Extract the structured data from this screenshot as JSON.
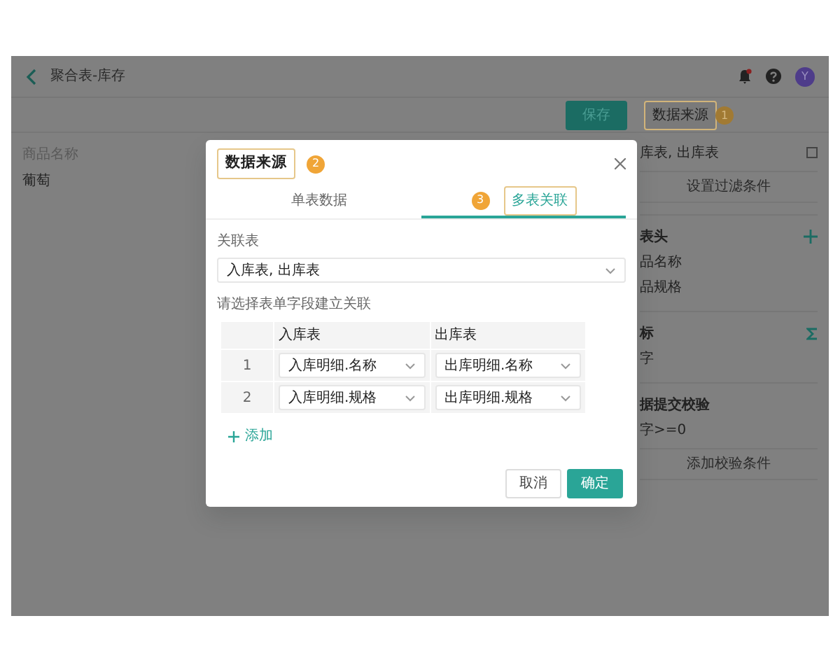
{
  "header": {
    "title": "聚合表-库存",
    "avatar": "Y"
  },
  "toolbar": {
    "save_button": "保存",
    "source_button": {
      "label": "数据来源",
      "highlighted": true,
      "badge": "1"
    }
  },
  "content": {
    "label": "商品名称",
    "value": "葡萄"
  },
  "right_panel": {
    "source_value": "库表, 出库表",
    "filter_button": "设置过滤条件",
    "sections": [
      {
        "title": "表头",
        "kind": "plus",
        "items": [
          "品名称",
          "品规格"
        ]
      },
      {
        "title": "标",
        "kind": "sum",
        "items": [
          "字"
        ]
      },
      {
        "title": "据提交校验",
        "kind": "none",
        "items": [
          "字>=0"
        ],
        "button": "添加校验条件"
      }
    ]
  },
  "dialog": {
    "title": "数据来源",
    "title_highlighted": true,
    "title_badge": "2",
    "tabs": [
      {
        "label": "单表数据",
        "selected": false,
        "highlighted": false
      },
      {
        "label": "多表关联",
        "selected": true,
        "highlighted": true,
        "badge": "3"
      }
    ],
    "related_label": "关联表",
    "related_value": "入库表, 出库表",
    "hint": "请选择表单字段建立关联",
    "table": {
      "columns": [
        "入库表",
        "出库表"
      ],
      "rows": [
        {
          "index": "1",
          "cells": [
            "入库明细.名称",
            "出库明细.名称"
          ]
        },
        {
          "index": "2",
          "cells": [
            "入库明细.规格",
            "出库明细.规格"
          ]
        }
      ]
    },
    "add_link": "添加",
    "buttons": [
      {
        "label": "取消",
        "kind": "secondary"
      },
      {
        "label": "确定",
        "kind": "primary"
      }
    ]
  }
}
